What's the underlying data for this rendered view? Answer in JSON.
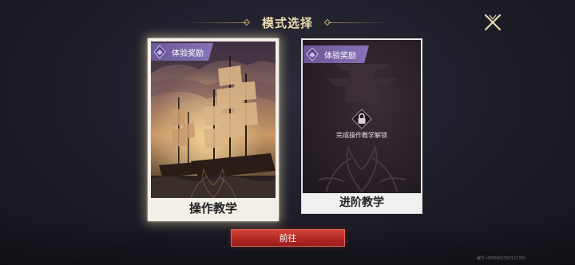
{
  "header": {
    "title": "模式选择"
  },
  "icons": {
    "close": "close-x-icon",
    "reward_gem": "gem-icon",
    "lock": "lock-icon"
  },
  "cards": [
    {
      "label": "操作教学",
      "reward_tag": "体验奖励",
      "selected": true,
      "locked": false
    },
    {
      "label": "进阶教学",
      "reward_tag": "体验奖励",
      "selected": false,
      "locked": true,
      "lock_text": "完成操作教学解锁"
    }
  ],
  "actions": {
    "go_label": "前往"
  },
  "footer": {
    "uid": "编号:4009801583121350"
  },
  "colors": {
    "accent_gold": "#c8aa6e",
    "button_red": "#b22a24",
    "tag_purple": "#7a67aa"
  }
}
